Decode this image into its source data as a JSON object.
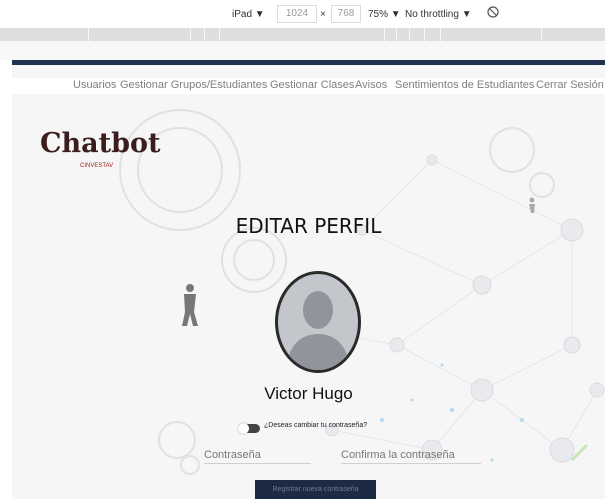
{
  "devtools": {
    "device": "iPad ▼",
    "width": "1024",
    "times": "×",
    "height": "768",
    "zoom": "75% ▼",
    "throttle": "No throttling ▼",
    "rotate_icon": "rotate-icon"
  },
  "nav": {
    "items": [
      "Usuarios",
      "Gestionar Grupos/Estudiantes",
      "Gestionar Clases",
      "Avisos",
      "Sentimientos de Estudiantes",
      "Cerrar Sesión"
    ]
  },
  "logo": {
    "text": "hatbot",
    "subtitle": "CINVESTAV"
  },
  "page": {
    "title": "EDITAR PERFIL",
    "user_name": "Victor Hugo",
    "toggle_label": "¿Deseas cambiar tu contraseña?",
    "password_placeholder": "Contraseña",
    "confirm_placeholder": "Confirma la contraseña",
    "submit_label": "Registrar nueva contraseña"
  },
  "colors": {
    "accent": "#1f3250",
    "button": "#1d2a44",
    "logo": "#3b1d1d",
    "logo_sub": "#a02424"
  }
}
